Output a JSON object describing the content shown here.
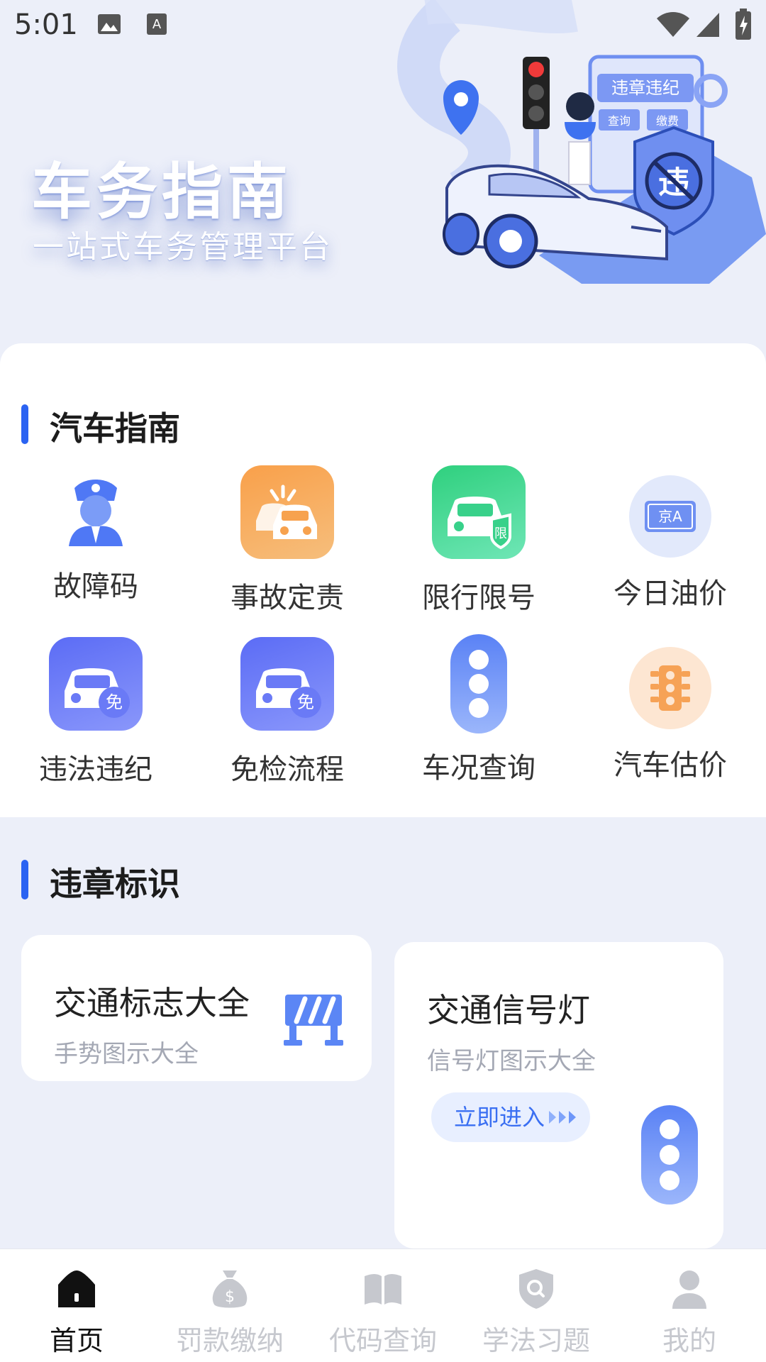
{
  "status_bar": {
    "time": "5:01"
  },
  "banner": {
    "title": "车务指南",
    "subtitle": "一站式车务管理平台",
    "sign_text": "违章违纪",
    "sign_btn1": "查询",
    "sign_btn2": "缴费",
    "shield_char": "违"
  },
  "guide": {
    "title": "汽车指南",
    "items": [
      {
        "label": "故障码",
        "icon": "police-icon"
      },
      {
        "label": "事故定责",
        "icon": "car-crash-icon"
      },
      {
        "label": "限行限号",
        "icon": "car-limit-icon",
        "badge": "限"
      },
      {
        "label": "今日油价",
        "icon": "license-plate-icon",
        "badge": "京A"
      },
      {
        "label": "违法违纪",
        "icon": "car-exempt-icon",
        "badge": "免"
      },
      {
        "label": "免检流程",
        "icon": "car-exempt-icon",
        "badge": "免"
      },
      {
        "label": "车况查询",
        "icon": "traffic-light-icon"
      },
      {
        "label": "汽车估价",
        "icon": "traffic-light-icon"
      }
    ]
  },
  "violation": {
    "title": "违章标识",
    "card_signs": {
      "title": "交通标志大全",
      "subtitle": "手势图示大全"
    },
    "card_lights": {
      "title": "交通信号灯",
      "subtitle": "信号灯图示大全",
      "button": "立即进入"
    }
  },
  "nav": {
    "items": [
      {
        "label": "首页",
        "active": true
      },
      {
        "label": "罚款缴纳",
        "active": false
      },
      {
        "label": "代码查询",
        "active": false
      },
      {
        "label": "学法习题",
        "active": false
      },
      {
        "label": "我的",
        "active": false
      }
    ]
  },
  "colors": {
    "accent": "#2b63f2",
    "background": "#eceff9"
  }
}
